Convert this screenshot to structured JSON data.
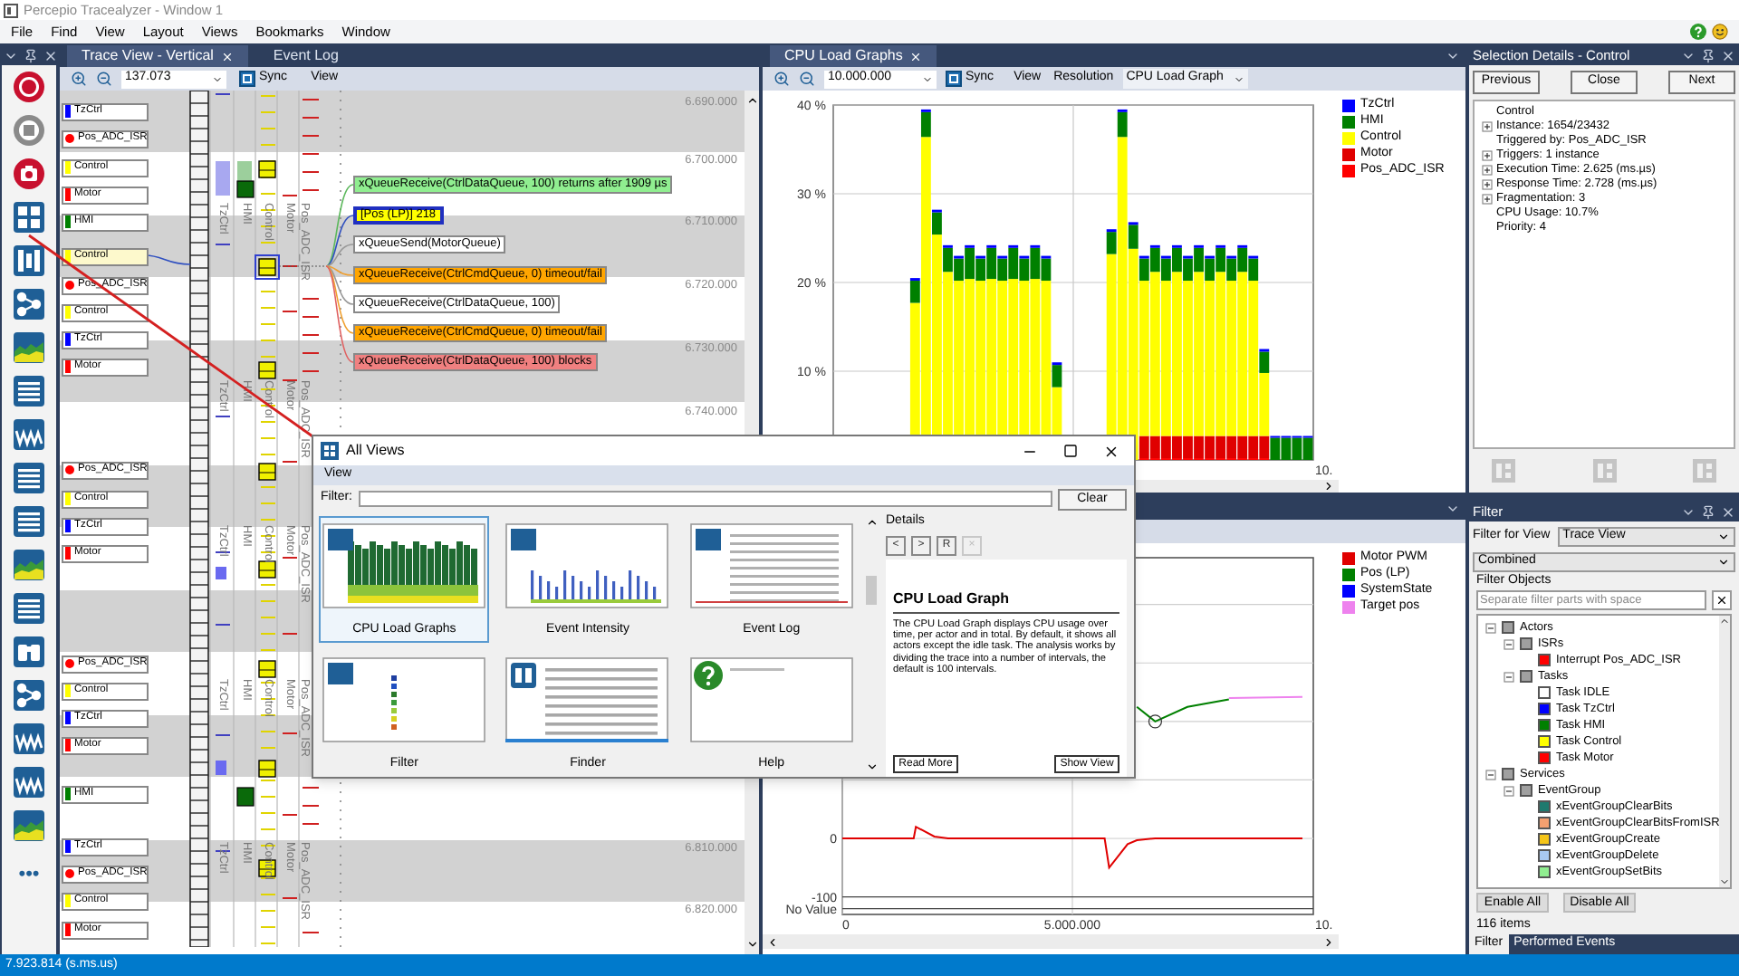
{
  "window": {
    "title": "Percepio Tracealyzer - Window 1"
  },
  "menu": [
    "File",
    "Find",
    "View",
    "Layout",
    "Views",
    "Bookmarks",
    "Window"
  ],
  "toolbox": {
    "tools": [
      {
        "kind": "record"
      },
      {
        "kind": "stop"
      },
      {
        "kind": "snapshot"
      },
      {
        "kind": "grid"
      },
      {
        "kind": "columns"
      },
      {
        "kind": "flow"
      },
      {
        "kind": "cpu"
      },
      {
        "kind": "list"
      },
      {
        "kind": "wave"
      },
      {
        "kind": "list"
      },
      {
        "kind": "list"
      },
      {
        "kind": "cpu"
      },
      {
        "kind": "list"
      },
      {
        "kind": "finder"
      },
      {
        "kind": "flow"
      },
      {
        "kind": "wave"
      },
      {
        "kind": "wave"
      },
      {
        "kind": "cpu"
      }
    ],
    "more": "•••"
  },
  "trace_view": {
    "tabs": [
      {
        "label": "Trace View - Vertical",
        "selected": true,
        "closable": true
      },
      {
        "label": "Event Log",
        "selected": false,
        "closable": false
      }
    ],
    "zoom_field": "137.073",
    "sync": "Sync",
    "view": "View",
    "actors": [
      {
        "name": "TzCtrl",
        "color": "#0000ff",
        "kind": "bar",
        "selected": false
      },
      {
        "name": "Pos_ADC_ISR",
        "color": "#ff0000",
        "kind": "dot",
        "selected": false
      },
      {
        "name": "Control",
        "color": "#ffff00",
        "kind": "bar",
        "selected": false
      },
      {
        "name": "Motor",
        "color": "#ff0000",
        "kind": "bar",
        "selected": false
      },
      {
        "name": "HMI",
        "color": "#008000",
        "kind": "bar",
        "selected": false
      },
      {
        "name": "Control",
        "color": "#ffff00",
        "kind": "bar",
        "selected": true
      },
      {
        "name": "Pos_ADC_ISR",
        "color": "#ff0000",
        "kind": "dot",
        "selected": false
      },
      {
        "name": "Control",
        "color": "#ffff00",
        "kind": "bar",
        "selected": false
      },
      {
        "name": "TzCtrl",
        "color": "#0000ff",
        "kind": "bar",
        "selected": false
      },
      {
        "name": "Motor",
        "color": "#ff0000",
        "kind": "bar",
        "selected": false
      },
      {
        "name": "Pos_ADC_ISR",
        "color": "#ff0000",
        "kind": "dot",
        "selected": false
      },
      {
        "name": "Control",
        "color": "#ffff00",
        "kind": "bar",
        "selected": false
      },
      {
        "name": "TzCtrl",
        "color": "#0000ff",
        "kind": "bar",
        "selected": false
      },
      {
        "name": "Motor",
        "color": "#ff0000",
        "kind": "bar",
        "selected": false
      },
      {
        "name": "Pos_ADC_ISR",
        "color": "#ff0000",
        "kind": "dot",
        "selected": false
      },
      {
        "name": "Control",
        "color": "#ffff00",
        "kind": "bar",
        "selected": false
      },
      {
        "name": "TzCtrl",
        "color": "#0000ff",
        "kind": "bar",
        "selected": false
      },
      {
        "name": "Motor",
        "color": "#ff0000",
        "kind": "bar",
        "selected": false
      },
      {
        "name": "HMI",
        "color": "#008000",
        "kind": "bar",
        "selected": false
      },
      {
        "name": "TzCtrl",
        "color": "#0000ff",
        "kind": "bar",
        "selected": false
      },
      {
        "name": "Pos_ADC_ISR",
        "color": "#ff0000",
        "kind": "dot",
        "selected": false
      },
      {
        "name": "Control",
        "color": "#ffff00",
        "kind": "bar",
        "selected": false
      },
      {
        "name": "Motor",
        "color": "#ff0000",
        "kind": "bar",
        "selected": false
      }
    ],
    "lane_labels": [
      [
        "TzCtrl",
        "HMI",
        "Control",
        "Motor",
        "Pos_ADC_ISR"
      ],
      [
        "TzCtrl",
        "HMI",
        "Control",
        "Motor",
        "Pos_ADC_ISR"
      ],
      [
        "TzCtrl",
        "HMI",
        "Control",
        "Motor",
        "Pos_ADC_ISR"
      ],
      [
        "TzCtrl",
        "HMI",
        "Control",
        "Motor",
        "Pos_ADC_ISR"
      ],
      [
        "TzCtrl",
        "HMI",
        "Control",
        "Motor",
        "Pos_ADC_ISR"
      ]
    ],
    "events": [
      {
        "text": "xQueueReceive(CtrlDataQueue, 100) returns after 1909 µs",
        "color": "#90ee90",
        "selected": false
      },
      {
        "text": "[Pos (LP)] 218",
        "color": "#ffff00",
        "selected": true
      },
      {
        "text": "xQueueSend(MotorQueue)",
        "color": "#ffffff",
        "selected": false
      },
      {
        "text": "xQueueReceive(CtrlCmdQueue, 0) timeout/fail",
        "color": "#ffa500",
        "selected": false
      },
      {
        "text": "xQueueReceive(CtrlDataQueue, 100)",
        "color": "#ffffff",
        "selected": false
      },
      {
        "text": "xQueueReceive(CtrlCmdQueue, 0) timeout/fail",
        "color": "#ffa500",
        "selected": false
      },
      {
        "text": "xQueueReceive(CtrlDataQueue, 100) blocks",
        "color": "#f08080",
        "selected": false
      }
    ],
    "times": [
      "6.690.000",
      "6.700.000",
      "6.710.000",
      "6.720.000",
      "6.730.000",
      "6.740.000",
      "6.810.000",
      "6.820.000"
    ]
  },
  "cpu_load": {
    "tab": {
      "label": "CPU Load Graphs",
      "selected": true
    },
    "zoom_field": "10.000.000",
    "sync": "Sync",
    "view": "View",
    "resolution": "Resolution",
    "graph_select": "CPU Load Graph",
    "x_end_label": "10.",
    "chart_data": {
      "type": "bar",
      "stacked": true,
      "grid": true,
      "ylim": [
        0,
        40
      ],
      "yticks": [
        {
          "value": 10,
          "label": "10 %"
        },
        {
          "value": 20,
          "label": "20 %"
        },
        {
          "value": 30,
          "label": "30 %"
        },
        {
          "value": 40,
          "label": "40 %"
        }
      ],
      "series": [
        {
          "name": "TzCtrl",
          "color": "#0000ff",
          "values": [
            0,
            0,
            0,
            0,
            0,
            0,
            0,
            0.3,
            0.3,
            0.3,
            0.3,
            0.3,
            0.3,
            0.3,
            0.3,
            0.3,
            0.3,
            0.3,
            0.3,
            0.3,
            0.3,
            0,
            0,
            0,
            0,
            0.3,
            0.3,
            0.3,
            0.3,
            0.3,
            0.3,
            0.3,
            0.3,
            0.3,
            0.3,
            0.3,
            0.3,
            0.3,
            0.3,
            0.3,
            0.2,
            0.2,
            0.2,
            0.2
          ]
        },
        {
          "name": "HMI",
          "color": "#008000",
          "values": [
            0,
            0,
            0,
            0,
            0,
            0,
            0,
            2.5,
            2.8,
            2.5,
            2.7,
            2.5,
            3.5,
            2.5,
            3.5,
            2.5,
            3.5,
            2.5,
            3.5,
            2.5,
            2.5,
            0,
            0,
            0,
            0,
            2.5,
            2.8,
            2.7,
            2.5,
            2.7,
            2.5,
            2.7,
            2.5,
            2.7,
            2.5,
            2.7,
            2.5,
            2.7,
            2.5,
            2.4,
            2.5,
            2.5,
            2.5,
            2.5
          ]
        },
        {
          "name": "Control",
          "color": "#ffff00",
          "values": [
            0,
            0,
            0,
            0,
            0,
            0,
            0,
            17.7,
            36.4,
            25.4,
            21.2,
            20.2,
            20.4,
            20.2,
            20.4,
            20.2,
            20.4,
            20.2,
            20.4,
            20.2,
            8.2,
            0,
            0,
            0,
            0,
            23.2,
            36.4,
            23.8,
            17.5,
            18.5,
            17.5,
            18.5,
            17.5,
            18.5,
            17.5,
            18.5,
            17.5,
            18.5,
            17.5,
            7.1,
            0,
            0,
            0,
            0
          ]
        },
        {
          "name": "Motor",
          "color": "#e00000",
          "values": [
            0,
            0,
            0,
            0,
            0,
            0,
            0,
            null,
            null,
            null,
            null,
            null,
            null,
            null,
            null,
            null,
            null,
            null,
            null,
            null,
            null,
            0,
            0,
            0,
            0,
            null,
            null,
            null,
            2.5,
            2.5,
            2.5,
            2.5,
            2.5,
            2.5,
            2.5,
            2.5,
            2.5,
            2.5,
            2.5,
            2.5,
            0,
            0,
            0,
            0
          ]
        },
        {
          "name": "Pos_ADC_ISR",
          "color": "#ff0000",
          "values": [
            0,
            0,
            0,
            0,
            0,
            0,
            0,
            null,
            null,
            null,
            null,
            null,
            null,
            null,
            null,
            null,
            null,
            null,
            null,
            null,
            null,
            0,
            0,
            0,
            0,
            null,
            null,
            null,
            0.2,
            0.2,
            0.2,
            0.2,
            0.2,
            0.2,
            0.2,
            0.2,
            0.2,
            0.2,
            0.2,
            0.2,
            0,
            0,
            0,
            0
          ]
        }
      ]
    }
  },
  "signal_plot": {
    "x_end_label": "10.",
    "chart_data": {
      "type": "line",
      "grid": true,
      "xlim": [
        0,
        10236220
      ],
      "ylim": [
        -130,
        480
      ],
      "yticks": [
        {
          "value": 0,
          "label": "0"
        },
        {
          "value": -100,
          "label": "-100"
        },
        {
          "value": -120,
          "label": "No Value"
        }
      ],
      "xticks": [
        {
          "value": 0,
          "label": "0"
        },
        {
          "value": 5000000,
          "label": "5.000.000"
        }
      ],
      "x": [
        0,
        1550000,
        1600000,
        2000000,
        2300000,
        5700000,
        5800000,
        6200000,
        6400000,
        6800000,
        7500000,
        8400000,
        10000000
      ],
      "series": [
        {
          "name": "Motor PWM",
          "color": "#e00000",
          "values": [
            0,
            0,
            20,
            3,
            0,
            0,
            -50,
            -10,
            -3,
            0,
            0,
            0,
            0
          ]
        },
        {
          "name": "Pos (LP)",
          "color": "#008000",
          "values": [
            null,
            null,
            null,
            null,
            null,
            null,
            null,
            null,
            225,
            200,
            225,
            238,
            null
          ]
        },
        {
          "name": "SystemState",
          "color": "#0000ff",
          "values": [
            null,
            null,
            null,
            null,
            null,
            null,
            null,
            null,
            null,
            null,
            null,
            null,
            null
          ]
        },
        {
          "name": "Target pos",
          "color": "#ee82ee",
          "values": [
            null,
            null,
            null,
            null,
            null,
            null,
            null,
            null,
            null,
            null,
            null,
            240,
            242
          ]
        }
      ]
    }
  },
  "selection_details": {
    "title": "Selection Details - Control",
    "buttons": [
      "Previous",
      "Close",
      "Next"
    ],
    "items": [
      {
        "label": "Control",
        "collapsed": false
      },
      {
        "label": "Instance: 1654/23432",
        "collapsed": true
      },
      {
        "label": "Triggered by: Pos_ADC_ISR",
        "collapsed": false
      },
      {
        "label": "Triggers: 1 instance",
        "collapsed": true
      },
      {
        "label": "Execution Time: 2.625 (ms.µs)",
        "collapsed": true
      },
      {
        "label": "Response Time: 2.728 (ms.µs)",
        "collapsed": true
      },
      {
        "label": "Fragmentation: 3",
        "collapsed": true
      },
      {
        "label": "CPU Usage: 10.7%",
        "collapsed": false
      },
      {
        "label": "Priority: 4",
        "collapsed": false
      }
    ]
  },
  "filter": {
    "title": "Filter",
    "for_view_label": "Filter for View",
    "view_select": "Trace View",
    "mode_select": "Combined",
    "objects_label": "Filter Objects",
    "search_placeholder": "Separate filter parts with space",
    "tree": [
      {
        "label": "Actors",
        "color": "#a0a0a0",
        "expanded": true,
        "children": [
          {
            "label": "ISRs",
            "color": "#a0a0a0",
            "expanded": true,
            "children": [
              {
                "label": "Interrupt Pos_ADC_ISR",
                "color": "#ff0000"
              }
            ]
          },
          {
            "label": "Tasks",
            "color": "#a0a0a0",
            "expanded": true,
            "children": [
              {
                "label": "Task IDLE",
                "color": "#ffffff"
              },
              {
                "label": "Task TzCtrl",
                "color": "#0000ff"
              },
              {
                "label": "Task HMI",
                "color": "#008000"
              },
              {
                "label": "Task Control",
                "color": "#ffff00"
              },
              {
                "label": "Task Motor",
                "color": "#ff0000"
              }
            ]
          }
        ]
      },
      {
        "label": "Services",
        "color": "#a0a0a0",
        "expanded": true,
        "children": [
          {
            "label": "EventGroup",
            "color": "#a0a0a0",
            "expanded": true,
            "children": [
              {
                "label": "xEventGroupClearBits",
                "color": "#1e7a6e"
              },
              {
                "label": "xEventGroupClearBitsFromISR",
                "color": "#f4a070"
              },
              {
                "label": "xEventGroupCreate",
                "color": "#f5c518"
              },
              {
                "label": "xEventGroupDelete",
                "color": "#a8c8f0"
              },
              {
                "label": "xEventGroupSetBits",
                "color": "#90ee90"
              }
            ]
          }
        ]
      }
    ],
    "buttons": [
      "Enable All",
      "Disable All"
    ],
    "count": "116 items",
    "tabs": [
      {
        "label": "Filter",
        "selected": true
      },
      {
        "label": "Performed Events",
        "selected": false
      }
    ]
  },
  "all_views_dialog": {
    "title": "All Views",
    "menu": [
      "View"
    ],
    "filter_label": "Filter:",
    "clear": "Clear",
    "views": [
      {
        "label": "CPU Load Graphs",
        "kind": "cpu",
        "selected": true
      },
      {
        "label": "Event Intensity",
        "kind": "intensity",
        "selected": false
      },
      {
        "label": "Event Log",
        "kind": "log",
        "selected": false
      },
      {
        "label": "Filter",
        "kind": "filter",
        "selected": false
      },
      {
        "label": "Finder",
        "kind": "finder",
        "selected": false
      },
      {
        "label": "Help",
        "kind": "help",
        "selected": false
      }
    ],
    "details": {
      "label": "Details",
      "nav": [
        {
          "text": "<",
          "disabled": false
        },
        {
          "text": ">",
          "disabled": false
        },
        {
          "text": "R",
          "disabled": false
        },
        {
          "text": "×",
          "disabled": true
        }
      ],
      "heading": "CPU Load Graph",
      "text": "The CPU Load Graph displays CPU usage over time, per actor and in total. By default, it shows all actors except the idle task. The analysis works by dividing the trace into a number of intervals, the default is 100 intervals.",
      "buttons": [
        "Read More",
        "Show View"
      ]
    }
  },
  "status_bar": "7.923.814 (s.ms.us)"
}
